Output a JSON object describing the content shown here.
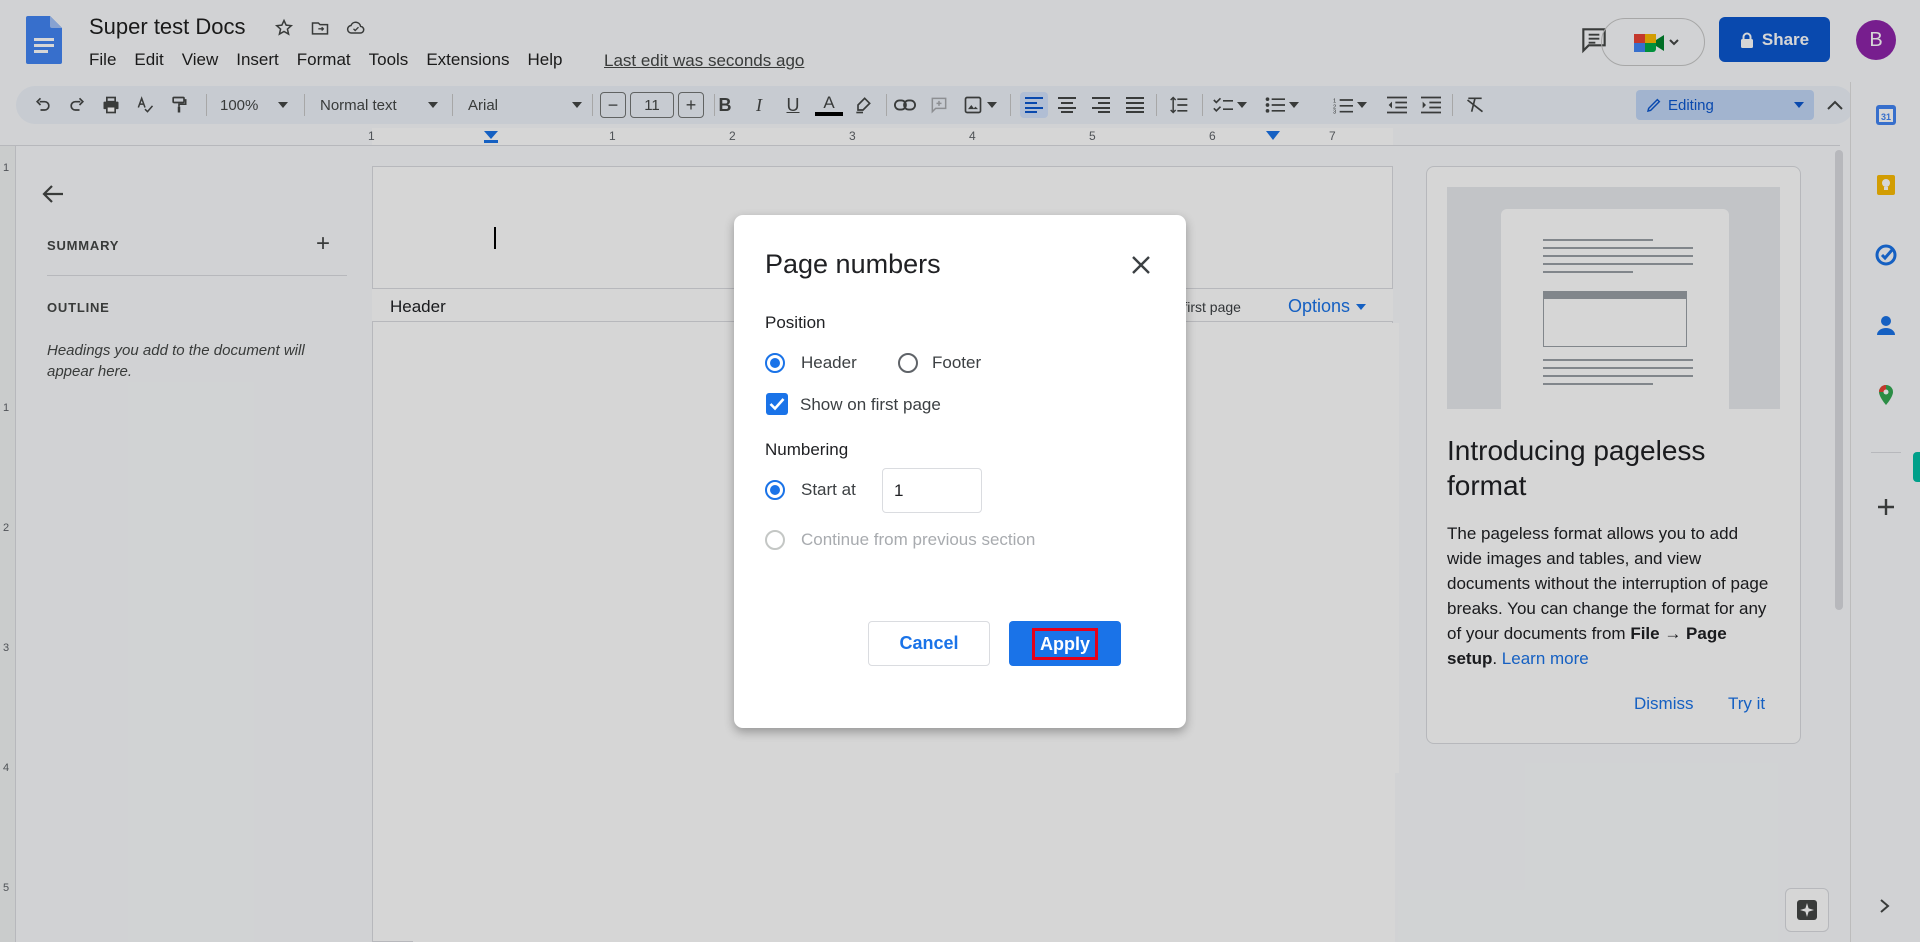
{
  "app": {
    "doc_title": "Super test Docs",
    "last_edit": "Last edit was seconds ago",
    "avatar_letter": "B",
    "brand_color": "#0b57d0"
  },
  "menu": [
    "File",
    "Edit",
    "View",
    "Insert",
    "Format",
    "Tools",
    "Extensions",
    "Help"
  ],
  "header_actions": {
    "share_label": "Share"
  },
  "toolbar": {
    "zoom": "100%",
    "style": "Normal text",
    "font": "Arial",
    "font_size": "11",
    "minus": "−",
    "plus": "+",
    "mode": "Editing"
  },
  "ruler": {
    "h_ticks": [
      "1",
      "1",
      "2",
      "3",
      "4",
      "5",
      "6",
      "7"
    ],
    "v_ticks": [
      "1",
      "1",
      "2",
      "3",
      "4",
      "5"
    ]
  },
  "left_panel": {
    "summary": "SUMMARY",
    "add": "+",
    "outline": "OUTLINE",
    "outline_hint": "Headings you add to the document will appear here."
  },
  "document": {
    "header_label": "Header",
    "first_page_text": "ent first page",
    "options_label": "Options"
  },
  "right_panel": {
    "title": "Introducing pageless format",
    "body_1": "The pageless format allows you to add wide images and tables, and view documents without the interruption of page breaks. You can change the format for any of your documents from ",
    "body_bold": "File → Page setup",
    "body_2": ". ",
    "learn_more": "Learn more",
    "dismiss": "Dismiss",
    "try_it": "Try it"
  },
  "dialog": {
    "title": "Page numbers",
    "position_label": "Position",
    "header_option": "Header",
    "footer_option": "Footer",
    "show_first_page": "Show on first page",
    "numbering_label": "Numbering",
    "start_at_label": "Start at",
    "start_at_value": "1",
    "continue_label": "Continue from previous section",
    "cancel_label": "Cancel",
    "apply_label": "Apply",
    "position_selected": "Header",
    "show_first_page_checked": true,
    "numbering_selected": "Start at"
  }
}
